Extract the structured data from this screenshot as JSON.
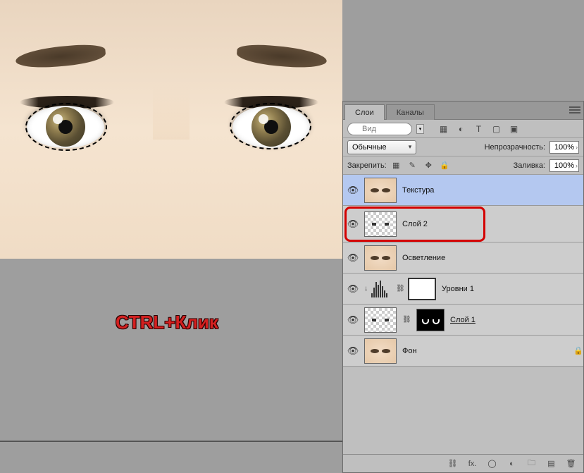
{
  "annotation": "CTRL+Клик",
  "panel": {
    "tabs": [
      "Слои",
      "Каналы"
    ],
    "search": {
      "placeholder": "Вид"
    },
    "blend_mode": "Обычные",
    "opacity": {
      "label": "Непрозрачность:",
      "value": "100%"
    },
    "fill": {
      "label": "Заливка:",
      "value": "100%"
    },
    "lock_label": "Закрепить:"
  },
  "layers": [
    {
      "name": "Текстура",
      "thumb": "face",
      "selected": true
    },
    {
      "name": "Слой 2",
      "thumb": "transp",
      "selected": false,
      "highlighted": true
    },
    {
      "name": "Осветление",
      "thumb": "face",
      "selected": false
    },
    {
      "name": "Уровни 1",
      "thumb": "levels",
      "selected": false
    },
    {
      "name": "Слой 1",
      "thumb": "masked",
      "selected": false,
      "underline": true
    },
    {
      "name": "Фон",
      "thumb": "face",
      "selected": false,
      "locked": true
    }
  ]
}
